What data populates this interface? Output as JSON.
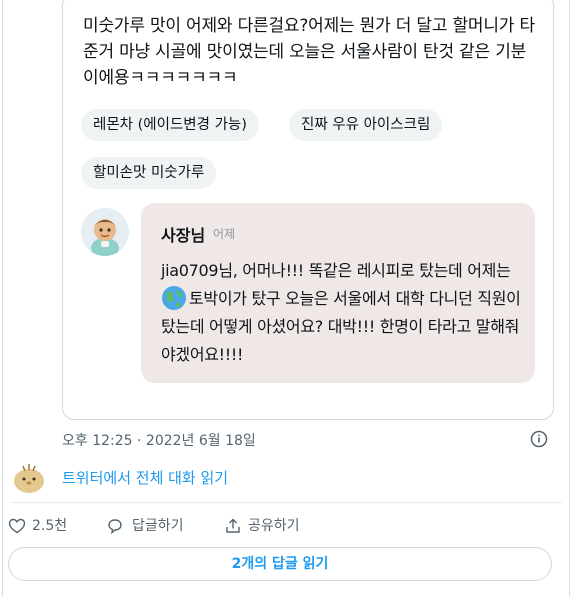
{
  "review": {
    "text": "미숫가루 맛이 어제와 다른걸요?어제는 뭔가 더 달고 할머니가 타준거 마냥 시골에 맛이였는데  오늘은 서울사람이 탄것 같은 기분이에용ㅋㅋㅋㅋㅋㅋㅋ",
    "chips": [
      "레몬차 (에이드변경 가능)",
      "진짜 우유 아이스크림",
      "할미손맛 미숫가루"
    ]
  },
  "owner_reply": {
    "name": "사장님",
    "time": "어제",
    "text_before_emoji": "jia0709님, 어머나!!! 똑같은 레시피로 탔는데 어제는 ",
    "emoji": "earth-globe-icon",
    "text_after_emoji": "토박이가 탔구 오늘은 서울에서 대학 다니던 직원이 탔는데 어떻게 아셨어요? 대박!!! 한명이 타라고 말해줘야겠어요!!!!"
  },
  "tweet": {
    "timestamp": "오후 12:25 · 2022년 6월 18일",
    "thread_link": "트위터에서 전체 대화 읽기"
  },
  "actions": {
    "like_count": "2.5천",
    "reply_label": "답글하기",
    "share_label": "공유하기",
    "read_replies_label": "2개의 답글 읽기"
  },
  "colors": {
    "link": "#1d9bf0",
    "muted": "#536471",
    "reply_bg": "#efe8e6",
    "chip_bg": "#eff3f4"
  }
}
